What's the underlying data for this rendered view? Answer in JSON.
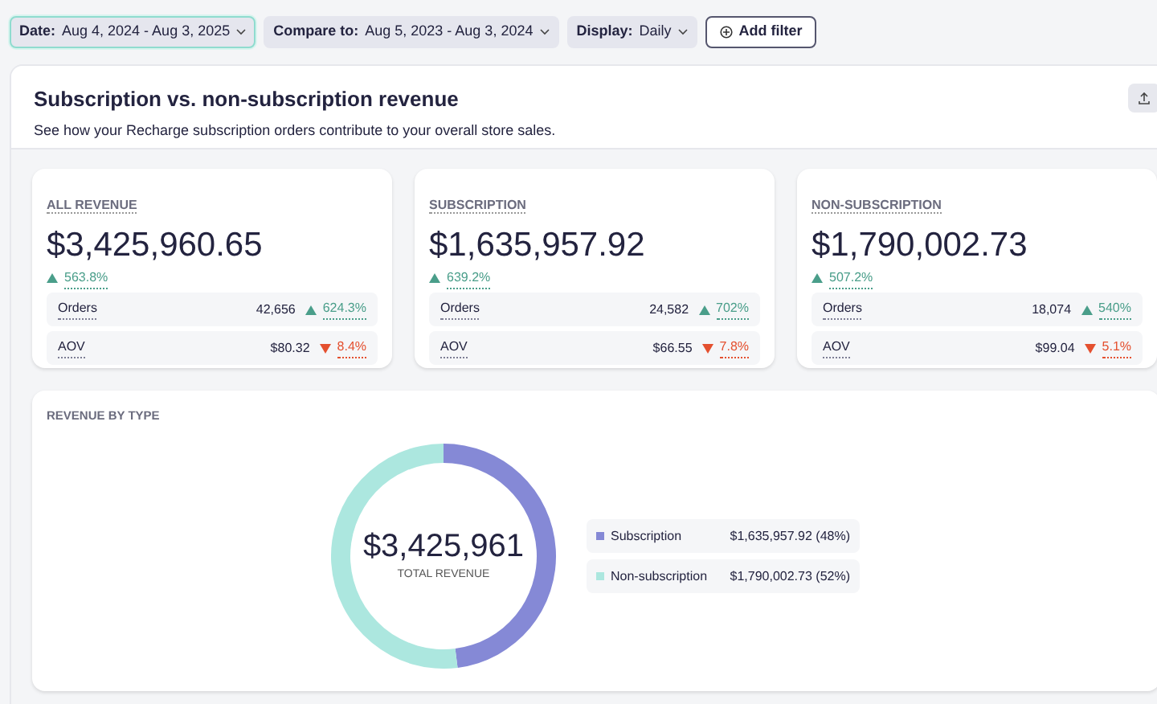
{
  "filters": [
    {
      "kind": "select",
      "label": "Date:",
      "value": "Aug 4, 2024 - Aug 3, 2025",
      "selected": true
    },
    {
      "kind": "select",
      "label": "Compare to:",
      "value": "Aug 5, 2023 - Aug 3, 2024",
      "selected": false
    },
    {
      "kind": "select",
      "label": "Display:",
      "value": "Daily",
      "selected": false
    },
    {
      "kind": "add",
      "label": "Add filter",
      "selected": false
    }
  ],
  "header": {
    "title": "Subscription vs. non-subscription revenue",
    "subtitle": "See how your Recharge subscription orders contribute to your overall store sales."
  },
  "cards": [
    {
      "title": "ALL REVENUE",
      "value": "$3,425,960.65",
      "change": "563.8%",
      "increase": true,
      "rows": [
        {
          "label": "Orders",
          "value": "42,656",
          "change": "624.3%",
          "increase": true
        },
        {
          "label": "AOV",
          "value": "$80.32",
          "change": "8.4%",
          "increase": false
        }
      ]
    },
    {
      "title": "SUBSCRIPTION",
      "value": "$1,635,957.92",
      "change": "639.2%",
      "increase": true,
      "rows": [
        {
          "label": "Orders",
          "value": "24,582",
          "change": "702%",
          "increase": true
        },
        {
          "label": "AOV",
          "value": "$66.55",
          "change": "7.8%",
          "increase": false
        }
      ]
    },
    {
      "title": "NON-SUBSCRIPTION",
      "value": "$1,790,002.73",
      "change": "507.2%",
      "increase": true,
      "rows": [
        {
          "label": "Orders",
          "value": "18,074",
          "change": "540%",
          "increase": true
        },
        {
          "label": "AOV",
          "value": "$99.04",
          "change": "5.1%",
          "increase": false
        }
      ]
    }
  ],
  "revenue_by_type": {
    "title": "REVENUE BY TYPE",
    "total": "$3,425,961",
    "total_label": "TOTAL REVENUE",
    "legend": [
      {
        "value": "$1,635,957.92 (48%)",
        "color": "#8589d6"
      },
      {
        "value": "$1,790,002.73 (52%)",
        "color": "#ace7df"
      }
    ],
    "chart_data": {
      "type": "donut",
      "categories": [
        "Subscription",
        "Non-subscription"
      ],
      "values": [
        48,
        52
      ]
    }
  }
}
